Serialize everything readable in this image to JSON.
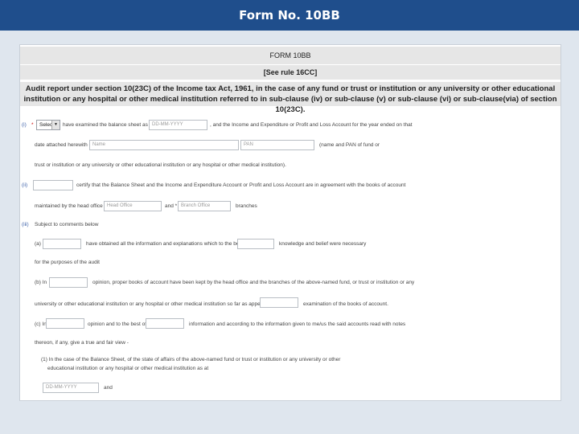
{
  "topbar": {
    "title": "Form No. 10BB"
  },
  "form": {
    "heading": "FORM 10BB",
    "rule": "[See rule 16CC]",
    "description": "Audit report under section 10(23C) of the Income tax Act, 1961, in the case of any fund or trust or institution or any university or other educational institution or any hospital or other medical institution referred to in sub-clause (iv) or sub-clause (v) or sub-clause (vi) or sub-clause(via) of section 10(23C).",
    "item1": {
      "num": "(i)",
      "star": "*",
      "select_value": "Select",
      "text_a": "have examined the balance sheet as at *",
      "date_placeholder": "DD-MM-YYYY",
      "text_b": ", and the Income and Expenditure or Profit and Loss Account for the year ended on that",
      "text_c": "date attached herewith of *",
      "name_placeholder": "Name",
      "pan_placeholder": "PAN",
      "text_d": "(name and PAN of fund or",
      "text_e": "trust or institution or any university or other educational institution or any hospital or other medical institution)."
    },
    "item2": {
      "num": "(ii)",
      "text_a": "certify that the Balance Sheet and the Income and Expenditure Account or Profit and Loss Account are in agreement with the books of account",
      "text_b": "maintained by the head office at *",
      "head_office_placeholder": "Head Office",
      "text_and": "and *",
      "branch_office_placeholder": "Branch Office",
      "text_branches": "branches"
    },
    "item3": {
      "num": "(iii)",
      "text": "Subject to comments below"
    },
    "item_a": {
      "num": "(a)",
      "text_a": "have obtained all the information and explanations which to the best of",
      "text_b": "knowledge and belief were necessary",
      "text_c": "for the purposes of the audit"
    },
    "item_b": {
      "num": "(b) In",
      "text_a": "opinion, proper books of account have been kept by the head office and the branches of the above-named fund, or trust or institution or any",
      "text_b": "university or other educational institution or any hospital or other medical institution so far as appears from",
      "text_c": "examination of the books of account."
    },
    "item_c": {
      "num": "(c) In",
      "text_a": "opinion and to the best of",
      "text_b": "information and according to the information given to me/us the said accounts read with notes",
      "text_c": "thereon, if any, give a true and fair view -"
    },
    "item_c1": {
      "text_a": "(1) In the case of the Balance Sheet, of the state of affairs of the above-named fund or trust or institution or any university or other",
      "text_b": "educational institution or any hospital or other medical institution as at",
      "date_placeholder": "DD-MM-YYYY",
      "text_and": "and"
    }
  }
}
